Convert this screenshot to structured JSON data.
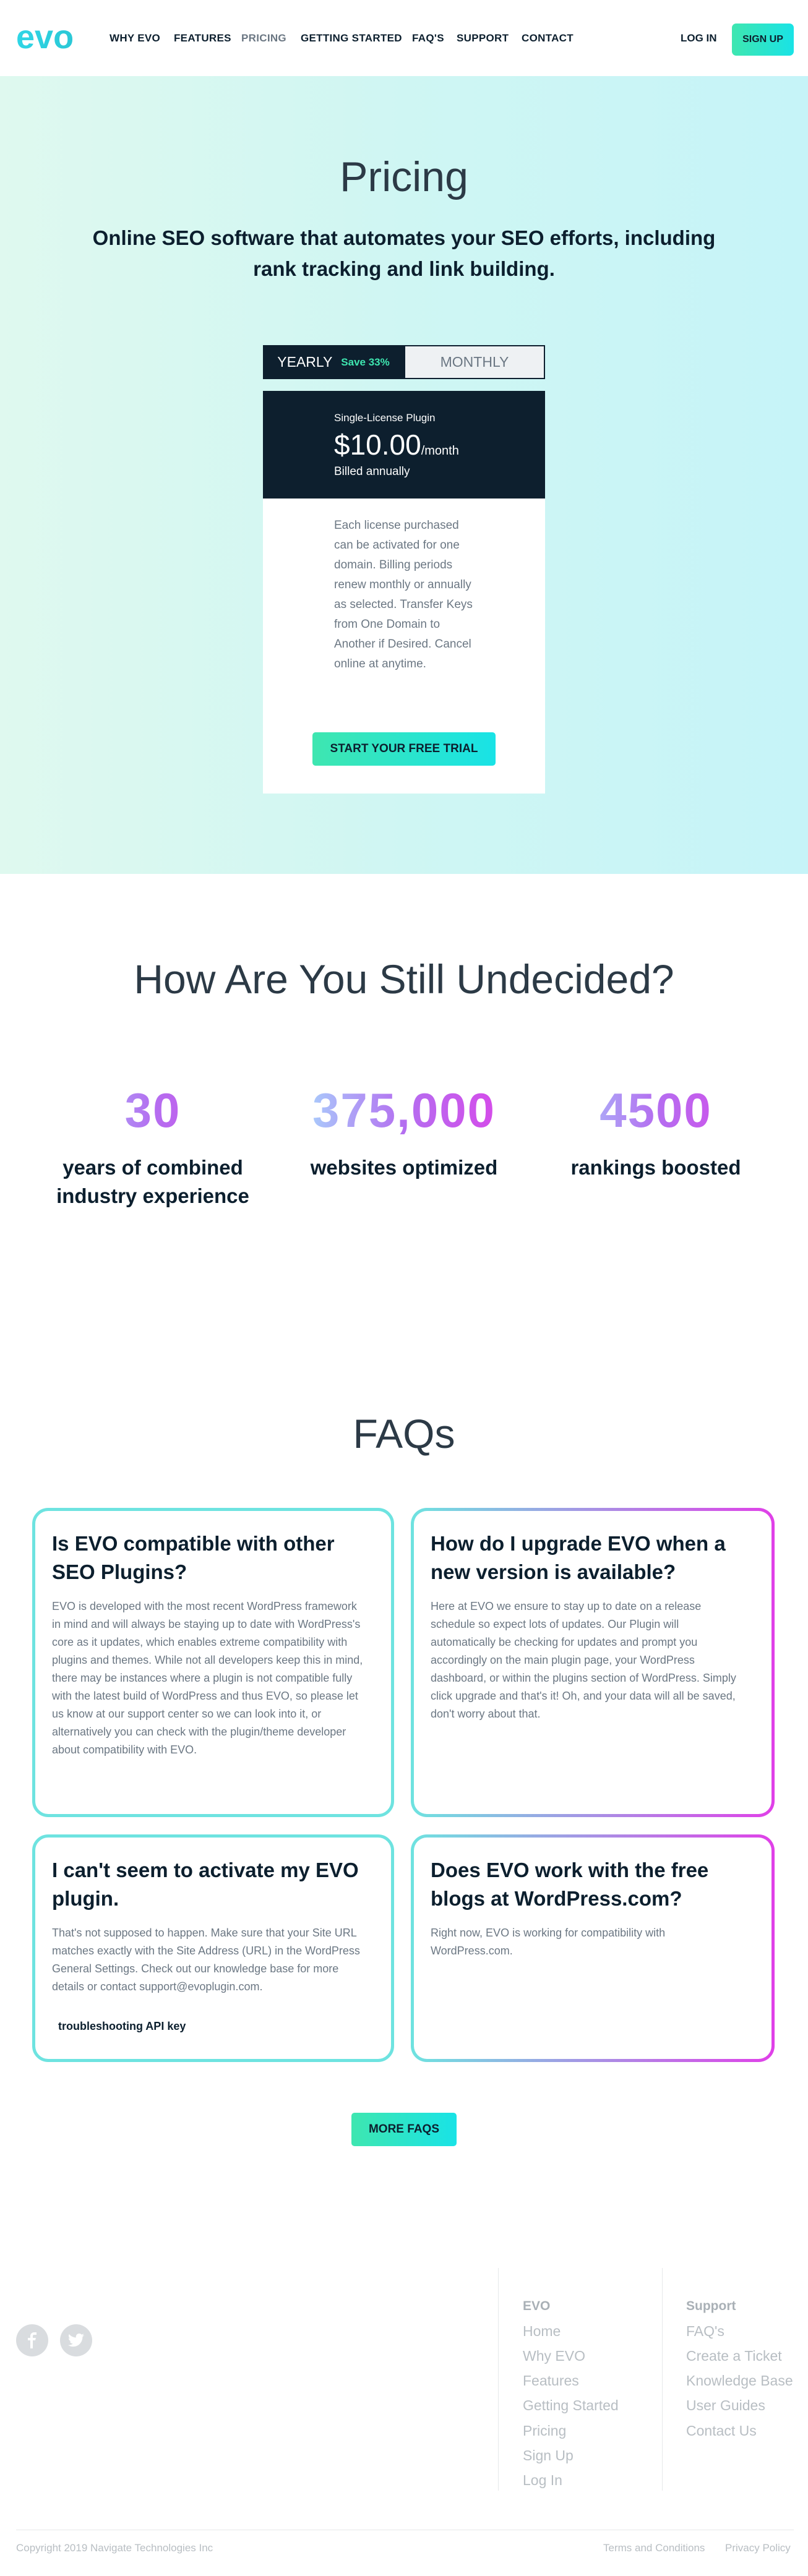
{
  "nav": {
    "logo_text": "evo",
    "links": [
      "WHY EVO",
      "FEATURES",
      "PRICING",
      "GETTING STARTED",
      "FAQ'S",
      "SUPPORT",
      "CONTACT"
    ],
    "login": "LOG IN",
    "signup": "SIGN UP"
  },
  "hero": {
    "title": "Pricing",
    "subtitle": "Online SEO software that automates your SEO efforts, including rank tracking and link building."
  },
  "toggle": {
    "yearly": "YEARLY",
    "save": "Save 33%",
    "monthly": "MONTHLY"
  },
  "plan": {
    "name": "Single-License Plugin",
    "price": "$10.00",
    "per": "/month",
    "billed": "Billed annually",
    "description": "Each license purchased can be activated for one domain. Billing periods renew monthly or annually as selected. Transfer Keys from One Domain to Another if Desired. Cancel online at anytime.",
    "cta": "START YOUR FREE TRIAL"
  },
  "undecided": {
    "title": "How Are You Still Undecided?",
    "stats": [
      {
        "number": "30",
        "label": "years of combined industry experience"
      },
      {
        "number": "375,000",
        "label": "websites optimized"
      },
      {
        "number": "4500",
        "label": "rankings boosted"
      }
    ]
  },
  "faqs": {
    "title": "FAQs",
    "items": [
      {
        "question": "Is EVO compatible with other SEO Plugins?",
        "answer": "EVO is developed with the most recent WordPress framework in mind and will always be staying up to date with WordPress's core as it updates, which enables extreme compatibility with plugins and themes. While not all developers keep this in mind, there may be instances where a plugin is not compatible fully with the latest build of WordPress and thus EVO, so please let us know at our support center so we can look into it, or alternatively you can check with the plugin/theme developer about compatibility with EVO."
      },
      {
        "question": "How do I upgrade EVO when a new version is available?",
        "answer": "Here at EVO we ensure to stay up to date on a release schedule so expect lots of updates. Our Plugin will automatically be checking for updates and prompt you accordingly on the main plugin page, your WordPress dashboard, or within the plugins section of WordPress. Simply click upgrade and that's it! Oh, and your data will all be saved, don't worry about that."
      },
      {
        "question": "I can't seem to activate my EVO plugin.",
        "answer": "That's not supposed to happen. Make sure that your Site URL matches exactly with the Site Address (URL) in the WordPress General Settings. Check out our knowledge base for more details or contact support@evoplugin.com.",
        "tag": "troubleshooting API key"
      },
      {
        "question": "Does EVO work with the free blogs at WordPress.com?",
        "answer": "Right now, EVO is working for compatibility with WordPress.com."
      }
    ],
    "more": "MORE FAQS"
  },
  "footer": {
    "social": [
      "facebook-icon",
      "twitter-icon"
    ],
    "evo_heading": "EVO",
    "evo_links": [
      "Home",
      "Why EVO",
      "Features",
      "Getting Started",
      "Pricing",
      "Sign Up",
      "Log In"
    ],
    "support_heading": "Support",
    "support_links": [
      "FAQ's",
      "Create a Ticket",
      "Knowledge Base",
      "User Guides",
      "Contact Us"
    ],
    "copyright": "Copyright 2019 Navigate Technologies Inc",
    "terms": "Terms and Conditions",
    "privacy": "Privacy Policy"
  },
  "colors": {
    "accent": "#3ee6b0",
    "accent2": "#19e3e6",
    "dark": "#0d1f2e",
    "stat_purple": "#b46ef0",
    "stat_pink": "#e040e8"
  }
}
